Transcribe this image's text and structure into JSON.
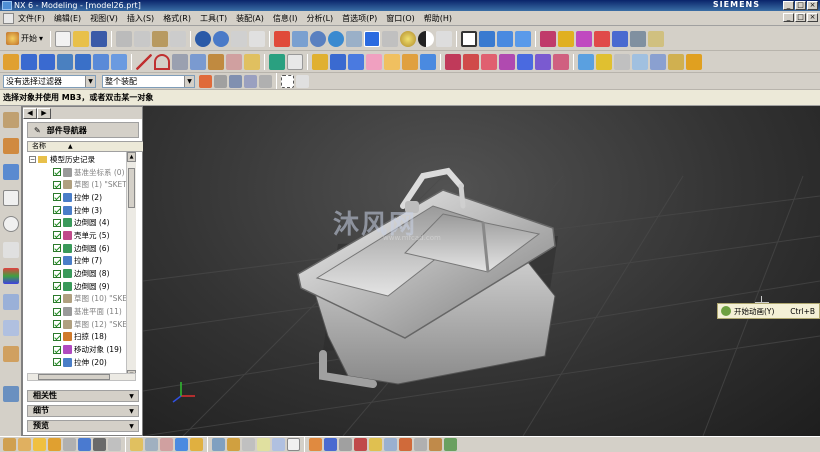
{
  "window": {
    "title": "NX 6 - Modeling - [model26.prt]",
    "brand": "SIEMENS",
    "controls": [
      "_",
      "□",
      "×"
    ]
  },
  "menubar": {
    "items": [
      "文件(F)",
      "编辑(E)",
      "视图(V)",
      "插入(S)",
      "格式(R)",
      "工具(T)",
      "装配(A)",
      "信息(I)",
      "分析(L)",
      "首选项(P)",
      "窗口(O)",
      "帮助(H)"
    ]
  },
  "toolbar": {
    "start_label": "开始"
  },
  "selection_bar": {
    "filter_value": "没有选择过滤器",
    "scope_value": "整个装配"
  },
  "cue_line": "选择对象并使用 MB3，或者双击某一对象",
  "navigator": {
    "title": "部件导航器",
    "column_header": "名称",
    "root": {
      "label": "模型历史记录",
      "expand": "−"
    },
    "items": [
      {
        "label": "基准坐标系 (0)",
        "dim": true,
        "icon_color": "#9a9a9a"
      },
      {
        "label": "草图 (1) \"SKET",
        "dim": true,
        "icon_color": "#b0a080"
      },
      {
        "label": "拉伸 (2)",
        "dim": false,
        "icon_color": "#4a7ec8"
      },
      {
        "label": "拉伸 (3)",
        "dim": false,
        "icon_color": "#4a7ec8"
      },
      {
        "label": "边倒圆 (4)",
        "dim": false,
        "icon_color": "#3a9a5a"
      },
      {
        "label": "壳单元 (5)",
        "dim": false,
        "icon_color": "#c04a8a"
      },
      {
        "label": "边倒圆 (6)",
        "dim": false,
        "icon_color": "#3a9a5a"
      },
      {
        "label": "拉伸 (7)",
        "dim": false,
        "icon_color": "#4a7ec8"
      },
      {
        "label": "边倒圆 (8)",
        "dim": false,
        "icon_color": "#3a9a5a"
      },
      {
        "label": "边倒圆 (9)",
        "dim": false,
        "icon_color": "#3a9a5a"
      },
      {
        "label": "草图 (10) \"SKE",
        "dim": true,
        "icon_color": "#b0a080"
      },
      {
        "label": "基准平面 (11)",
        "dim": true,
        "icon_color": "#9a9a9a"
      },
      {
        "label": "草图 (12) \"SKE",
        "dim": true,
        "icon_color": "#b0a080"
      },
      {
        "label": "扫掠 (18)",
        "dim": false,
        "icon_color": "#d07a2a"
      },
      {
        "label": "移动对象 (19)",
        "dim": false,
        "icon_color": "#b04ac0"
      },
      {
        "label": "拉伸 (20)",
        "dim": false,
        "icon_color": "#4a7ec8"
      }
    ],
    "panels": [
      "相关性",
      "细节",
      "预览"
    ]
  },
  "viewport": {
    "watermark": "沐风网",
    "watermark_url": "www.mfcad.com"
  },
  "hint": {
    "label": "开始动画(Y)",
    "shortcut": "Ctrl+B"
  },
  "colors": {
    "viewport": "#333333",
    "accent": "#0a246a",
    "hint_bg": "#f4f0d6"
  }
}
